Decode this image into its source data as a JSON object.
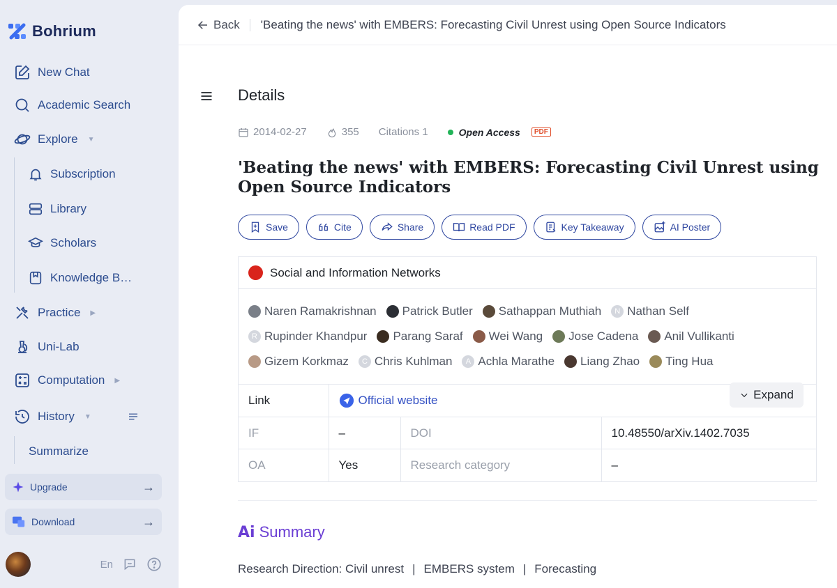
{
  "app": {
    "name": "Bohrium"
  },
  "sidebar": {
    "items": [
      {
        "label": "New Chat",
        "icon": "edit-icon"
      },
      {
        "label": "Academic Search",
        "icon": "search-icon"
      },
      {
        "label": "Explore",
        "icon": "planet-icon"
      },
      {
        "label": "Subscription",
        "icon": "bell-icon"
      },
      {
        "label": "Library",
        "icon": "library-icon"
      },
      {
        "label": "Scholars",
        "icon": "graduation-cap-icon"
      },
      {
        "label": "Knowledge B…",
        "icon": "book-icon"
      },
      {
        "label": "Practice",
        "icon": "tools-icon"
      },
      {
        "label": "Uni-Lab",
        "icon": "lab-icon"
      },
      {
        "label": "Computation",
        "icon": "calculator-icon"
      },
      {
        "label": "History",
        "icon": "history-icon"
      },
      {
        "label": "Summarize",
        "icon": ""
      }
    ],
    "upgrade_label": "Upgrade",
    "download_label": "Download",
    "language": "En"
  },
  "topbar": {
    "back_label": "Back",
    "title": "'Beating the news' with EMBERS: Forecasting Civil Unrest using Open Source Indicators"
  },
  "details": {
    "heading": "Details",
    "date": "2014-02-27",
    "likes": "355",
    "citations": "Citations 1",
    "open_access": "Open Access",
    "pdf_badge": "PDF",
    "title": "'Beating the news' with EMBERS: Forecasting Civil Unrest using Open Source Indicators"
  },
  "actions": {
    "save": "Save",
    "cite": "Cite",
    "share": "Share",
    "read_pdf": "Read PDF",
    "key_takeaway": "Key Takeaway",
    "ai_poster": "AI Poster"
  },
  "journal": "Social and Information Networks",
  "authors": {
    "row1": [
      "Naren Ramakrishnan",
      "Patrick Butler",
      "Sathappan Muthiah",
      "Nathan Self"
    ],
    "row2": [
      "Rupinder Khandpur",
      "Parang Saraf",
      "Wei Wang",
      "Jose Cadena",
      "Anil Vullikanti"
    ],
    "row3": [
      "Gizem Korkmaz",
      "Chris Kuhlman",
      "Achla Marathe",
      "Liang Zhao",
      "Ting Hua"
    ],
    "avatar_letters": {
      "nathan": "N",
      "rupinder": "R",
      "chris": "C",
      "achla": "A"
    },
    "expand_label": "Expand"
  },
  "info": {
    "link_label": "Link",
    "link_value": "Official website",
    "if_label": "IF",
    "if_value": "–",
    "doi_label": "DOI",
    "doi_value": "10.48550/arXiv.1402.7035",
    "oa_label": "OA",
    "oa_value": "Yes",
    "category_label": "Research category",
    "category_value": "–"
  },
  "summary": {
    "ai_mark": "Ai",
    "heading": "Summary",
    "direction_label": "Research Direction: Civil unrest",
    "topic2": "EMBERS system",
    "topic3": "Forecasting",
    "separator": "|"
  },
  "colors": {
    "accent": "#2f47a0",
    "brand": "#1d2a5b",
    "summary": "#6b3fd4",
    "open_access_dot": "#21b357"
  }
}
